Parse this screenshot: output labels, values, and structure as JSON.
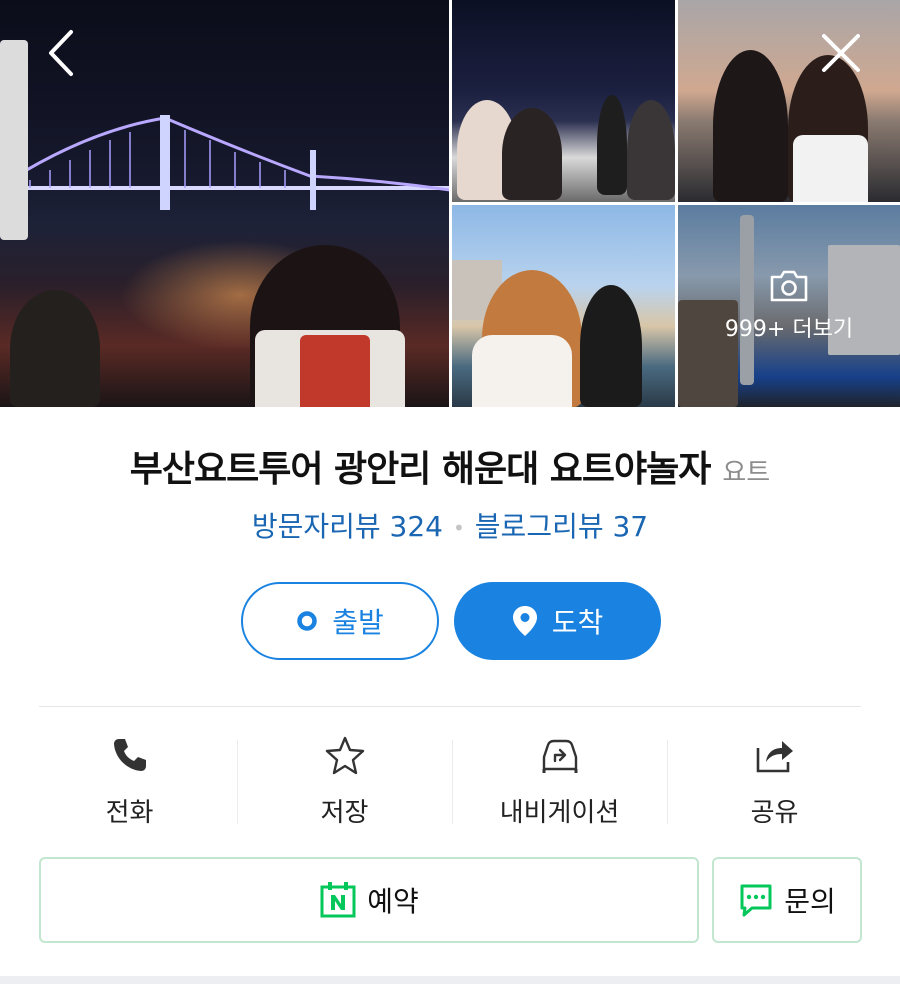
{
  "gallery": {
    "more_label": "999+ 더보기"
  },
  "place": {
    "name": "부산요트투어 광안리 해운대 요트야놀자",
    "category": "요트"
  },
  "reviews": {
    "visitor": "방문자리뷰 324",
    "blog": "블로그리뷰 37",
    "separator": "•"
  },
  "route": {
    "start_label": "출발",
    "arrive_label": "도착"
  },
  "actions": [
    {
      "label": "전화",
      "icon": "phone-icon"
    },
    {
      "label": "저장",
      "icon": "star-icon"
    },
    {
      "label": "내비게이션",
      "icon": "car-navigation-icon"
    },
    {
      "label": "공유",
      "icon": "share-icon"
    }
  ],
  "bottom": {
    "reserve_label": "예약",
    "inquiry_label": "문의"
  },
  "colors": {
    "accent_blue": "#1a82e0",
    "review_blue": "#1a66b3",
    "naver_green": "#03c75a"
  }
}
